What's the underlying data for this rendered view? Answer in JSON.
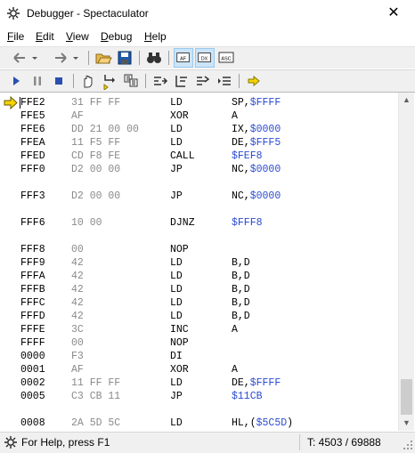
{
  "window": {
    "title": "Debugger - Spectaculator",
    "close_glyph": "✕"
  },
  "menu": [
    {
      "label": "File",
      "underline": "F"
    },
    {
      "label": "Edit",
      "underline": "E"
    },
    {
      "label": "View",
      "underline": "V"
    },
    {
      "label": "Debug",
      "underline": "D"
    },
    {
      "label": "Help",
      "underline": "H"
    }
  ],
  "toolbar1": [
    "back-arrow-icon",
    "back-dropdown-icon",
    "forward-arrow-icon",
    "forward-dropdown-icon",
    "open-folder-icon",
    "save-disk-icon",
    "find-binoculars-icon",
    "view-af-icon",
    "view-dx-icon",
    "view-asc-icon"
  ],
  "toolbar1_labels": {
    "af": "AF",
    "dx": "DX",
    "asc": "ASC"
  },
  "toolbar2": [
    "run-icon",
    "pause-icon",
    "stop-icon",
    "hand-icon",
    "step-into-icon",
    "step-over-icon",
    "step-out-icon",
    "run-to-cursor-icon",
    "toggle-breakpoint-icon",
    "set-next-icon",
    "goto-pc-icon"
  ],
  "disassembly": [
    {
      "addr": "FFE2",
      "bytes": "31 FF FF",
      "mnem": "LD",
      "ops": "SP,",
      "ops_hex": "$FFFF",
      "current": true
    },
    {
      "addr": "FFE5",
      "bytes": "AF",
      "mnem": "XOR",
      "ops": "A",
      "ops_hex": ""
    },
    {
      "addr": "FFE6",
      "bytes": "DD 21 00 00",
      "mnem": "LD",
      "ops": "IX,",
      "ops_hex": "$0000"
    },
    {
      "addr": "FFEA",
      "bytes": "11 F5 FF",
      "mnem": "LD",
      "ops": "DE,",
      "ops_hex": "$FFF5"
    },
    {
      "addr": "FFED",
      "bytes": "CD F8 FE",
      "mnem": "CALL",
      "ops": "",
      "ops_hex": "$FEF8"
    },
    {
      "addr": "FFF0",
      "bytes": "D2 00 00",
      "mnem": "JP",
      "ops": "NC,",
      "ops_hex": "$0000"
    },
    {
      "blank": true
    },
    {
      "addr": "FFF3",
      "bytes": "D2 00 00",
      "mnem": "JP",
      "ops": "NC,",
      "ops_hex": "$0000"
    },
    {
      "blank": true
    },
    {
      "addr": "FFF6",
      "bytes": "10 00",
      "mnem": "DJNZ",
      "ops": "",
      "ops_hex": "$FFF8"
    },
    {
      "blank": true
    },
    {
      "addr": "FFF8",
      "bytes": "00",
      "mnem": "NOP",
      "ops": "",
      "ops_hex": ""
    },
    {
      "addr": "FFF9",
      "bytes": "42",
      "mnem": "LD",
      "ops": "B,D",
      "ops_hex": ""
    },
    {
      "addr": "FFFA",
      "bytes": "42",
      "mnem": "LD",
      "ops": "B,D",
      "ops_hex": ""
    },
    {
      "addr": "FFFB",
      "bytes": "42",
      "mnem": "LD",
      "ops": "B,D",
      "ops_hex": ""
    },
    {
      "addr": "FFFC",
      "bytes": "42",
      "mnem": "LD",
      "ops": "B,D",
      "ops_hex": ""
    },
    {
      "addr": "FFFD",
      "bytes": "42",
      "mnem": "LD",
      "ops": "B,D",
      "ops_hex": ""
    },
    {
      "addr": "FFFE",
      "bytes": "3C",
      "mnem": "INC",
      "ops": "A",
      "ops_hex": ""
    },
    {
      "addr": "FFFF",
      "bytes": "00",
      "mnem": "NOP",
      "ops": "",
      "ops_hex": ""
    },
    {
      "addr": "0000",
      "bytes": "F3",
      "mnem": "DI",
      "ops": "",
      "ops_hex": ""
    },
    {
      "addr": "0001",
      "bytes": "AF",
      "mnem": "XOR",
      "ops": "A",
      "ops_hex": ""
    },
    {
      "addr": "0002",
      "bytes": "11 FF FF",
      "mnem": "LD",
      "ops": "DE,",
      "ops_hex": "$FFFF"
    },
    {
      "addr": "0005",
      "bytes": "C3 CB 11",
      "mnem": "JP",
      "ops": "",
      "ops_hex": "$11CB"
    },
    {
      "blank": true
    },
    {
      "addr": "0008",
      "bytes": "2A 5D 5C",
      "mnem": "LD",
      "ops": "HL,(",
      "ops_hex": "$5C5D",
      "ops_suffix": ")"
    }
  ],
  "status": {
    "help": "For Help, press F1",
    "tstates": "T: 4503 / 69888"
  },
  "colors": {
    "hex_operand": "#2b4bd0",
    "bytes": "#8a8a8a",
    "pc_arrow": "#f5d400"
  }
}
